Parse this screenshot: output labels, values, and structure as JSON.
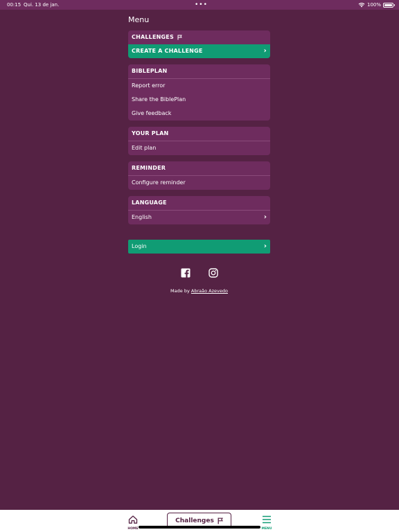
{
  "status_bar": {
    "time": "00:15",
    "date": "Qui. 13 de jan.",
    "battery": "100%"
  },
  "menu_title": "Menu",
  "sections": {
    "challenges": {
      "header": "CHALLENGES",
      "create": "CREATE A CHALLENGE"
    },
    "bibleplan": {
      "header": "BIBLEPLAN",
      "items": [
        "Report error",
        "Share the BiblePlan",
        "Give feedback"
      ]
    },
    "your_plan": {
      "header": "YOUR PLAN",
      "edit": "Edit plan"
    },
    "reminder": {
      "header": "REMINDER",
      "configure": "Configure reminder"
    },
    "language": {
      "header": "LANGUAGE",
      "current": "English"
    }
  },
  "login_label": "Login",
  "made_by": {
    "prefix": "Made by",
    "author": "Abraão Azevedo"
  },
  "tab_bar": {
    "home": "HOME",
    "challenges": "Challenges",
    "menu": "MENU"
  },
  "colors": {
    "background": "#552244",
    "card": "#6e2c5e",
    "accent": "#109c74"
  },
  "icons": [
    "flag-icon",
    "chevron-right-icon",
    "facebook-icon",
    "instagram-icon",
    "home-icon",
    "menu-icon",
    "wifi-icon",
    "battery-icon"
  ]
}
